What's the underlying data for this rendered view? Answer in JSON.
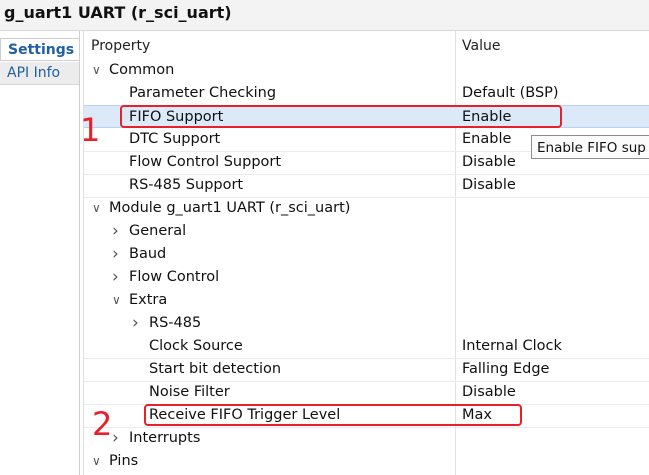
{
  "window": {
    "title": "g_uart1 UART (r_sci_uart)"
  },
  "side_tabs": [
    {
      "label": "Settings",
      "active": true
    },
    {
      "label": "API Info",
      "active": false
    }
  ],
  "columns": {
    "property": "Property",
    "value": "Value"
  },
  "rows": [
    {
      "label": "Common",
      "value": "",
      "level": 0,
      "toggle": "expanded"
    },
    {
      "label": "Parameter Checking",
      "value": "Default (BSP)",
      "level": 1,
      "toggle": "none"
    },
    {
      "label": "FIFO Support",
      "value": "Enable",
      "level": 1,
      "toggle": "none",
      "selected": true
    },
    {
      "label": "DTC Support",
      "value": "Enable",
      "level": 1,
      "toggle": "none"
    },
    {
      "label": "Flow Control Support",
      "value": "Disable",
      "level": 1,
      "toggle": "none"
    },
    {
      "label": "RS-485 Support",
      "value": "Disable",
      "level": 1,
      "toggle": "none"
    },
    {
      "label": "Module g_uart1 UART (r_sci_uart)",
      "value": "",
      "level": 0,
      "toggle": "expanded"
    },
    {
      "label": "General",
      "value": "",
      "level": 1,
      "toggle": "collapsed"
    },
    {
      "label": "Baud",
      "value": "",
      "level": 1,
      "toggle": "collapsed"
    },
    {
      "label": "Flow Control",
      "value": "",
      "level": 1,
      "toggle": "collapsed"
    },
    {
      "label": "Extra",
      "value": "",
      "level": 1,
      "toggle": "expanded"
    },
    {
      "label": "RS-485",
      "value": "",
      "level": 2,
      "toggle": "collapsed"
    },
    {
      "label": "Clock Source",
      "value": "Internal Clock",
      "level": 2,
      "toggle": "none"
    },
    {
      "label": "Start bit detection",
      "value": "Falling Edge",
      "level": 2,
      "toggle": "none"
    },
    {
      "label": "Noise Filter",
      "value": "Disable",
      "level": 2,
      "toggle": "none"
    },
    {
      "label": "Receive FIFO Trigger Level",
      "value": "Max",
      "level": 2,
      "toggle": "none"
    },
    {
      "label": "Interrupts",
      "value": "",
      "level": 1,
      "toggle": "collapsed"
    },
    {
      "label": "Pins",
      "value": "",
      "level": 0,
      "toggle": "expanded"
    }
  ],
  "tooltip": {
    "text": "Enable FIFO sup"
  },
  "annotations": {
    "one": "1",
    "two": "2"
  },
  "colors": {
    "highlight": "#e8202a",
    "selected_row": "#dbe9f8",
    "tab_text": "#1f5fa5"
  }
}
